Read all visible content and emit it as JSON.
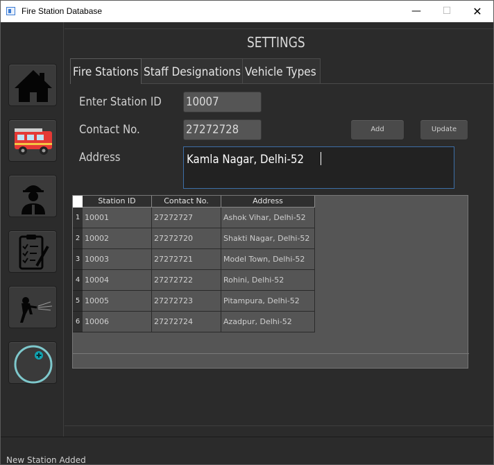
{
  "window": {
    "title": "Fire Station Database",
    "minimize": "—",
    "maximize": "☐",
    "close": "✕"
  },
  "sidebar": {
    "items": [
      {
        "name": "home",
        "icon": "home-icon"
      },
      {
        "name": "fire-truck",
        "icon": "fire-truck-icon"
      },
      {
        "name": "firefighter",
        "icon": "firefighter-icon"
      },
      {
        "name": "clipboard",
        "icon": "clipboard-icon"
      },
      {
        "name": "fire-hose",
        "icon": "fire-hose-icon"
      },
      {
        "name": "add",
        "icon": "add-circle-icon"
      }
    ]
  },
  "header": {
    "title": "SETTINGS"
  },
  "tabs": [
    {
      "label": "Fire Stations",
      "active": true
    },
    {
      "label": "Staff Designations",
      "active": false
    },
    {
      "label": "Vehicle Types",
      "active": false
    }
  ],
  "form": {
    "station_id_label": "Enter Station ID",
    "station_id_value": "10007",
    "contact_label": "Contact No.",
    "contact_value": "27272728",
    "address_label": "Address",
    "address_value": "Kamla Nagar, Delhi-52",
    "add_label": "Add",
    "update_label": "Update"
  },
  "table": {
    "columns": [
      "Station ID",
      "Contact No.",
      "Address"
    ],
    "rows": [
      {
        "num": "1",
        "id": "10001",
        "contact": "27272727",
        "address": "Ashok Vihar, Delhi-52"
      },
      {
        "num": "2",
        "id": "10002",
        "contact": "27272720",
        "address": "Shakti Nagar, Delhi-52"
      },
      {
        "num": "3",
        "id": "10003",
        "contact": "27272721",
        "address": "Model Town, Delhi-52"
      },
      {
        "num": "4",
        "id": "10004",
        "contact": "27272722",
        "address": "Rohini, Delhi-52"
      },
      {
        "num": "5",
        "id": "10005",
        "contact": "27272723",
        "address": "Pitampura, Delhi-52"
      },
      {
        "num": "6",
        "id": "10006",
        "contact": "27272724",
        "address": "Azadpur, Delhi-52"
      }
    ]
  },
  "status": {
    "text": "New Station Added"
  },
  "colors": {
    "background": "#2b2b2b",
    "accent_teal": "#7ec8cc",
    "focus_border": "#3d6fa8",
    "truck_red": "#e53935"
  }
}
